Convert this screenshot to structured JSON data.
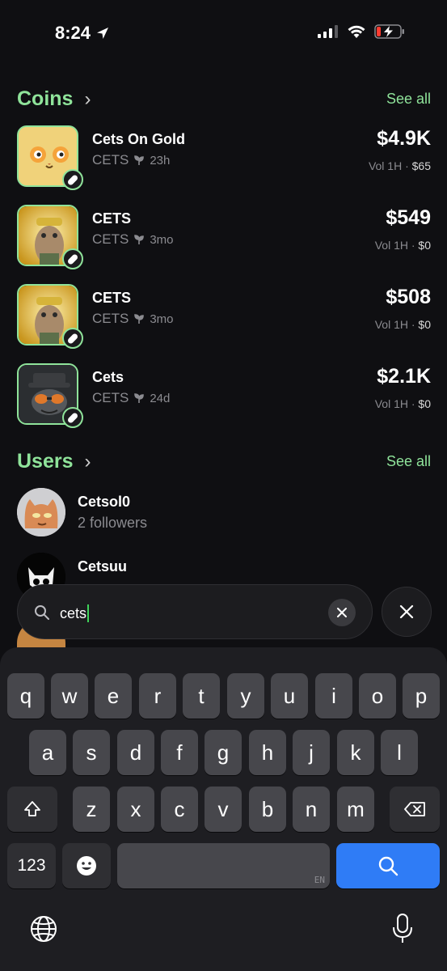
{
  "status_bar": {
    "time": "8:24"
  },
  "coins_section": {
    "title": "Coins",
    "see_all": "See all",
    "items": [
      {
        "name": "Cets On Gold",
        "ticker": "CETS",
        "age": "23h",
        "price": "$4.9K",
        "vol_label": "Vol 1H",
        "vol_value": "$65"
      },
      {
        "name": "CETS",
        "ticker": "CETS",
        "age": "3mo",
        "price": "$549",
        "vol_label": "Vol 1H",
        "vol_value": "$0"
      },
      {
        "name": "CETS",
        "ticker": "CETS",
        "age": "3mo",
        "price": "$508",
        "vol_label": "Vol 1H",
        "vol_value": "$0"
      },
      {
        "name": "Cets",
        "ticker": "CETS",
        "age": "24d",
        "price": "$2.1K",
        "vol_label": "Vol 1H",
        "vol_value": "$0"
      }
    ]
  },
  "users_section": {
    "title": "Users",
    "see_all": "See all",
    "items": [
      {
        "name": "Cetsol0",
        "followers": "2 followers"
      },
      {
        "name": "Cetsuu",
        "followers": ""
      }
    ]
  },
  "search": {
    "value": "cets"
  },
  "keyboard": {
    "row1": [
      "q",
      "w",
      "e",
      "r",
      "t",
      "y",
      "u",
      "i",
      "o",
      "p"
    ],
    "row2": [
      "a",
      "s",
      "d",
      "f",
      "g",
      "h",
      "j",
      "k",
      "l"
    ],
    "row3": [
      "z",
      "x",
      "c",
      "v",
      "b",
      "n",
      "m"
    ],
    "numbers_key": "123",
    "lang_label": "EN"
  },
  "colors": {
    "accent": "#8fe39a",
    "background": "#0f0f12",
    "search_blue": "#2f7cf6"
  }
}
